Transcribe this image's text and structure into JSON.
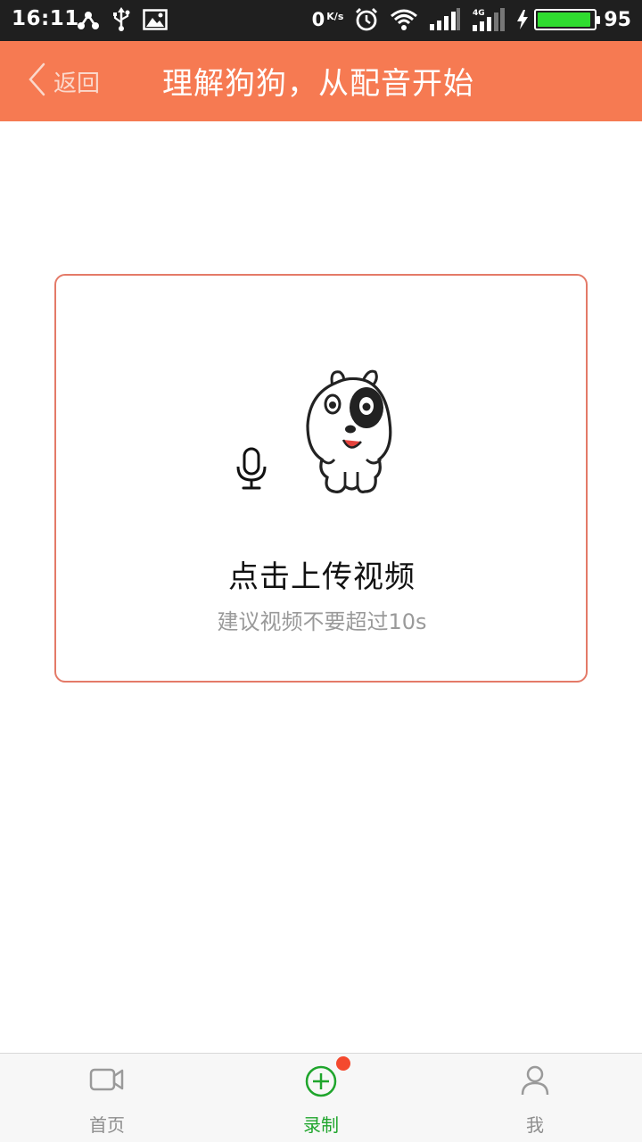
{
  "status_bar": {
    "time": "16:11",
    "net_speed": "0",
    "net_speed_unit": "K/s",
    "network_type": "4G",
    "battery_level": "95",
    "battery_fraction": 0.95,
    "left_icons": [
      "share-icon",
      "usb-icon",
      "image-icon"
    ],
    "right_icons": [
      "alarm-icon",
      "wifi-icon",
      "signal-icon",
      "signal-4g-icon",
      "charging-icon",
      "battery-icon"
    ]
  },
  "header": {
    "back_label": "返回",
    "title": "理解狗狗，从配音开始",
    "background": "#f67a52"
  },
  "upload": {
    "title": "点击上传视频",
    "hint": "建议视频不要超过10s",
    "icons": [
      "microphone-icon",
      "dog-mascot-icon"
    ],
    "border_color": "#e47a68"
  },
  "bottom_nav": {
    "items": [
      {
        "label": "首页",
        "icon": "video-camera-icon",
        "active": false
      },
      {
        "label": "录制",
        "icon": "plus-circle-icon",
        "active": true,
        "badge": true
      },
      {
        "label": "我",
        "icon": "user-icon",
        "active": false
      }
    ],
    "active_color": "#1fa52c"
  }
}
